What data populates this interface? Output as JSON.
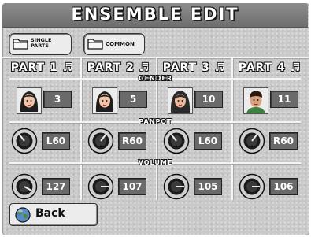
{
  "title": "ENSEMBLE EDIT",
  "tabs": [
    {
      "label_line1": "SINGLE",
      "label_line2": "PARTS"
    },
    {
      "label": "COMMON"
    }
  ],
  "sections": {
    "gender": "GENDER",
    "panpot": "PANPOT",
    "volume": "VOLUME"
  },
  "parts": [
    {
      "label": "PART 1 ♬",
      "gender": "3",
      "gender_icon": "female-face-icon",
      "panpot": "L60",
      "volume": "127"
    },
    {
      "label": "PART 2 ♬",
      "gender": "5",
      "gender_icon": "female-face-icon",
      "panpot": "R60",
      "volume": "107"
    },
    {
      "label": "PART 3 ♬",
      "gender": "10",
      "gender_icon": "female-face-icon",
      "panpot": "L60",
      "volume": "105"
    },
    {
      "label": "PART 4 ♬",
      "gender": "11",
      "gender_icon": "male-face-icon",
      "panpot": "R60",
      "volume": "106"
    }
  ],
  "back_button": {
    "label": "Back",
    "icon": "globe-icon"
  },
  "colors": {
    "panel": "#c9c9c9",
    "titlebar": "#7a7a7a",
    "value_box": "#6a6a6a"
  }
}
